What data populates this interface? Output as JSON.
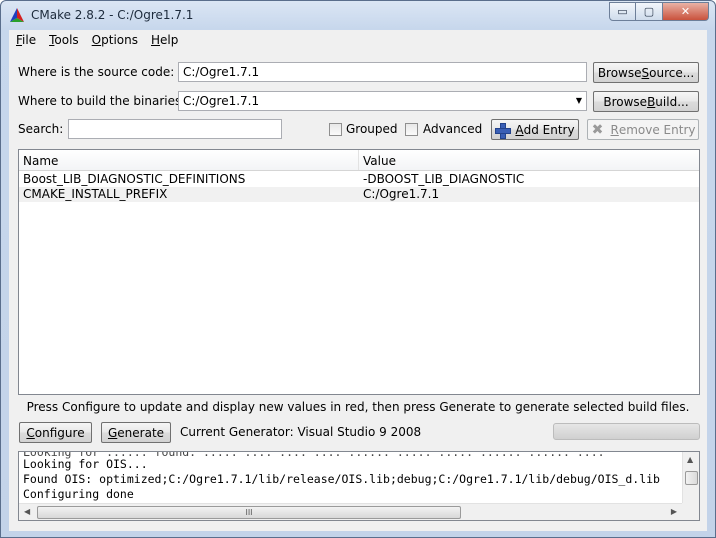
{
  "window": {
    "title": "CMake 2.8.2 - C:/Ogre1.7.1",
    "min_glyph": "▭",
    "max_glyph": "▢",
    "close_glyph": "✕"
  },
  "menu": [
    {
      "key": "F",
      "rest": "ile"
    },
    {
      "key": "T",
      "rest": "ools"
    },
    {
      "key": "O",
      "rest": "ptions"
    },
    {
      "key": "H",
      "rest": "elp"
    }
  ],
  "source": {
    "label": "Where is the source code:",
    "value": "C:/Ogre1.7.1",
    "browse_pre": "Browse ",
    "browse_key": "S",
    "browse_post": "ource..."
  },
  "build": {
    "label": "Where to build the binaries:",
    "value": "C:/Ogre1.7.1",
    "browse_pre": "Browse ",
    "browse_key": "B",
    "browse_post": "uild..."
  },
  "search": {
    "label": "Search:",
    "value": ""
  },
  "options": {
    "grouped": {
      "label": "Grouped",
      "checked": false
    },
    "advanced": {
      "label": "Advanced",
      "checked": false
    }
  },
  "entry": {
    "add_key": "A",
    "add_rest": "dd Entry",
    "remove_key": "R",
    "remove_rest": "emove Entry",
    "add_icon": "plus-icon",
    "remove_icon": "x-icon"
  },
  "table": {
    "columns": [
      "Name",
      "Value"
    ],
    "rows": [
      {
        "name": "Boost_LIB_DIAGNOSTIC_DEFINITIONS",
        "value": "-DBOOST_LIB_DIAGNOSTIC"
      },
      {
        "name": "CMAKE_INSTALL_PREFIX",
        "value": "C:/Ogre1.7.1"
      }
    ]
  },
  "hint": "Press Configure to update and display new values in red, then press Generate to generate selected build files.",
  "actions": {
    "configure_key": "C",
    "configure_rest": "onfigure",
    "generate_key": "G",
    "generate_rest": "enerate",
    "generator_text": "Current Generator: Visual Studio 9 2008"
  },
  "output": {
    "lines": [
      "Looking for OIS...",
      "Found OIS: optimized;C:/Ogre1.7.1/lib/release/OIS.lib;debug;C:/Ogre1.7.1/lib/debug/OIS_d.lib",
      "Configuring done"
    ],
    "cut_line": "Looking for ...... found: ..... .... .... .... ...... ..... ..... ...... ...... ....",
    "thumb_glyph": "III"
  },
  "colors": {
    "accent": "#3a5fb5",
    "titlebar": "#dbe6f4",
    "client": "#f0f0f0"
  }
}
